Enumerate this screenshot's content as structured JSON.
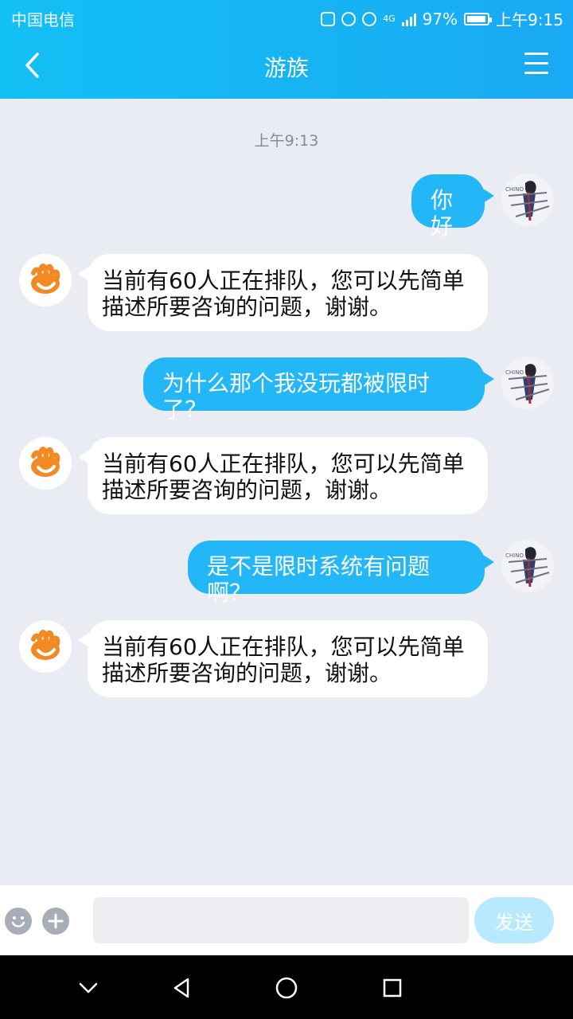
{
  "status_bar": {
    "carrier": "中国电信",
    "network": "4G",
    "battery": "97%",
    "battery_level": 0.97,
    "time": "上午9:15"
  },
  "header": {
    "title": "游族"
  },
  "chat": {
    "timestamp": "上午9:13",
    "messages": [
      {
        "sender": "user",
        "text": "你好"
      },
      {
        "sender": "service",
        "text": "当前有60人正在排队，您可以先简单描述所要咨询的问题，谢谢。"
      },
      {
        "sender": "user",
        "text": "为什么那个我没玩都被限时了？"
      },
      {
        "sender": "service",
        "text": "当前有60人正在排队，您可以先简单描述所要咨询的问题，谢谢。"
      },
      {
        "sender": "user",
        "text": "是不是限时系统有问题啊？"
      },
      {
        "sender": "service",
        "text": "当前有60人正在排队，您可以先简单描述所要咨询的问题，谢谢。"
      }
    ]
  },
  "input_bar": {
    "placeholder": "",
    "send_label": "发送"
  },
  "icons": {
    "back": "chevron-left-icon",
    "menu": "menu-icon",
    "emoji": "smile-icon",
    "add": "plus-icon",
    "service_avatar": "support-hand-icon",
    "user_avatar": "avatar-illustration"
  },
  "colors": {
    "header_start": "#13c0f5",
    "header_end": "#1aa9f4",
    "user_bubble": "#23b7f7",
    "chat_background": "#e9ecf2",
    "service_accent": "#f28a23",
    "send_disabled": "#b8eaff"
  }
}
